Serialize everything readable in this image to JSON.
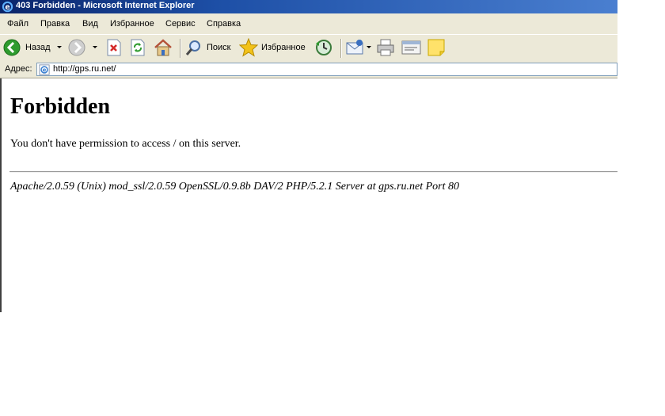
{
  "window": {
    "title": "403 Forbidden - Microsoft Internet Explorer"
  },
  "menu": {
    "items": [
      "Файл",
      "Правка",
      "Вид",
      "Избранное",
      "Сервис",
      "Справка"
    ]
  },
  "toolbar": {
    "back_label": "Назад",
    "search_label": "Поиск",
    "favorites_label": "Избранное"
  },
  "address": {
    "label": "Адрес:",
    "value": "http://gps.ru.net/"
  },
  "page": {
    "heading": "Forbidden",
    "message": "You don't have permission to access / on this server.",
    "server_signature": "Apache/2.0.59 (Unix) mod_ssl/2.0.59 OpenSSL/0.9.8b DAV/2 PHP/5.2.1 Server at gps.ru.net Port 80"
  },
  "colors": {
    "titlebar": "#0a246a",
    "chrome": "#ece9d8",
    "back_icon": "#2e9b2e",
    "stop_icon": "#d42a2a",
    "favorites_icon": "#f2c21a"
  }
}
